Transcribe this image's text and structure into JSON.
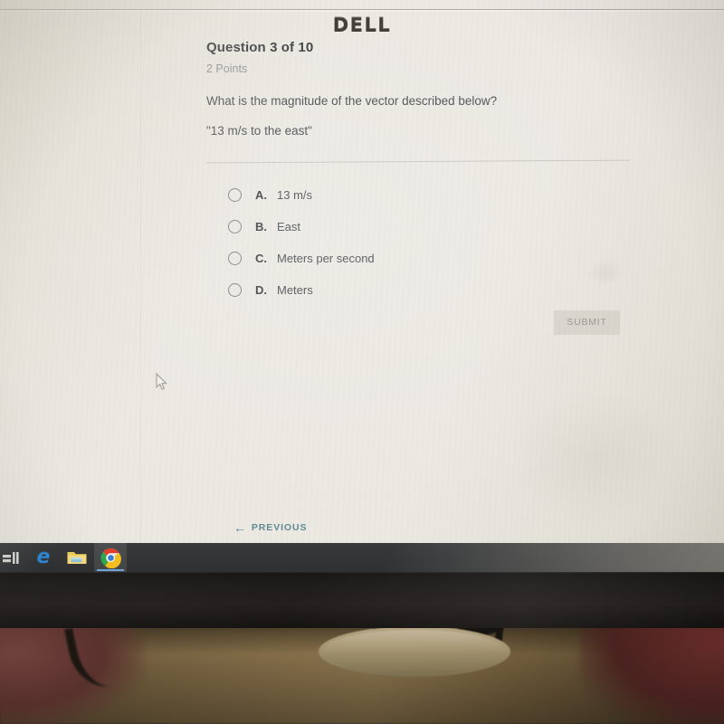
{
  "quiz": {
    "title": "Question 3 of 10",
    "points": "2 Points",
    "prompt": "What is the magnitude of the vector described below?",
    "quote": "\"13 m/s to the east\"",
    "options": [
      {
        "letter": "A.",
        "text": "13 m/s",
        "selected": false
      },
      {
        "letter": "B.",
        "text": "East",
        "selected": false
      },
      {
        "letter": "C.",
        "text": "Meters per second",
        "selected": false
      },
      {
        "letter": "D.",
        "text": "Meters",
        "selected": false
      }
    ],
    "submit_label": "SUBMIT",
    "previous_label": "PREVIOUS",
    "previous_arrow": "←"
  },
  "taskbar": {
    "items": [
      {
        "name": "pinned-app-icon",
        "label": ""
      },
      {
        "name": "edge-icon",
        "label": "e"
      },
      {
        "name": "file-explorer-icon",
        "label": ""
      },
      {
        "name": "chrome-icon",
        "label": "",
        "active": true
      }
    ]
  },
  "monitor": {
    "brand": "DELL"
  },
  "colors": {
    "screen_bg": "#ebe9e2",
    "heading": "#35393c",
    "body_text": "#4a4e52",
    "muted_text": "#8d9196",
    "link_teal": "#5f8b94",
    "submit_disabled_text": "#8b8d88",
    "taskbar_bg": "#2e3032",
    "bezel_black": "#181614"
  }
}
